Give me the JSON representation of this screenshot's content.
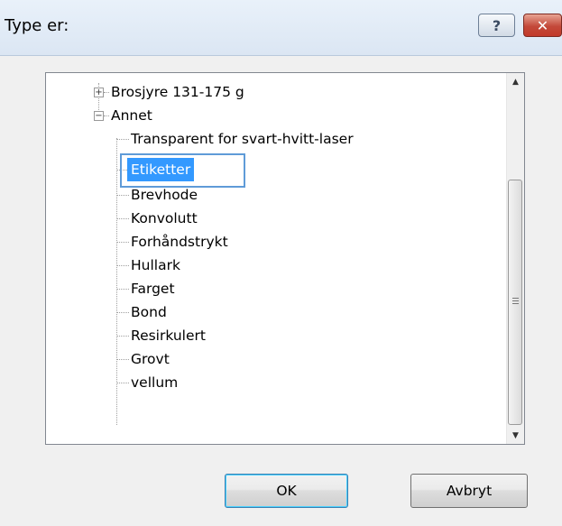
{
  "dialog": {
    "title": "Type er:",
    "help_glyph": "?",
    "close_glyph": "✕"
  },
  "tree": {
    "items": [
      {
        "label": "Brosjyre 131-175 g",
        "level": 1,
        "expander": "+"
      },
      {
        "label": "Annet",
        "level": 1,
        "expander": "−"
      },
      {
        "label": "Transparent for svart-hvitt-laser",
        "level": 2
      },
      {
        "label": "Etiketter",
        "level": 2,
        "selected": true
      },
      {
        "label": "Brevhode",
        "level": 2
      },
      {
        "label": "Konvolutt",
        "level": 2
      },
      {
        "label": "Forhåndstrykt",
        "level": 2
      },
      {
        "label": "Hullark",
        "level": 2
      },
      {
        "label": "Farget",
        "level": 2
      },
      {
        "label": "Bond",
        "level": 2
      },
      {
        "label": "Resirkulert",
        "level": 2
      },
      {
        "label": "Grovt",
        "level": 2
      },
      {
        "label": "vellum",
        "level": 2
      }
    ]
  },
  "scrollbar": {
    "up_glyph": "▲",
    "down_glyph": "▼"
  },
  "buttons": {
    "ok_label": "OK",
    "cancel_label": "Avbryt"
  }
}
